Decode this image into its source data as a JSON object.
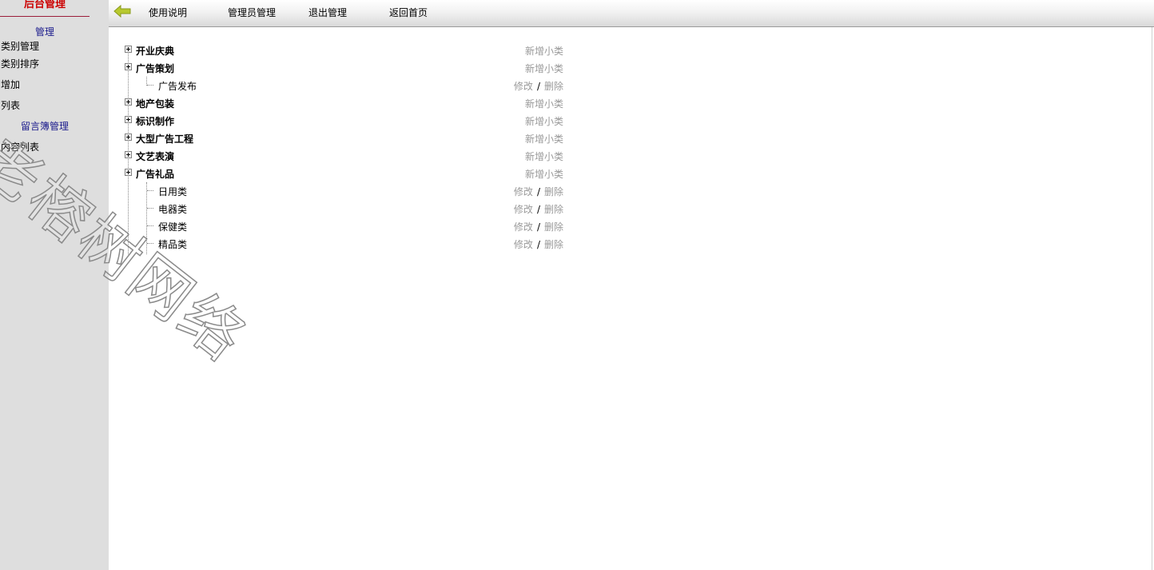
{
  "sidebar": {
    "title": "后台管理",
    "groups": [
      {
        "label": "管理",
        "items": [
          "类别管理",
          "类别排序",
          "增加",
          "列表"
        ]
      },
      {
        "label": "留言簿管理",
        "items": [
          "内容列表"
        ]
      }
    ]
  },
  "topbar": {
    "back_icon": "arrow-left-icon",
    "links": [
      "使用说明",
      "管理员管理",
      "退出管理",
      "返回首页"
    ]
  },
  "tree": {
    "categories": [
      {
        "name": "开业庆典",
        "action": "新增小类",
        "children": []
      },
      {
        "name": "广告策划",
        "action": "新增小类",
        "children": [
          {
            "name": "广告发布",
            "edit": "修改",
            "sep": "/",
            "delete": "删除"
          }
        ]
      },
      {
        "name": "地产包装",
        "action": "新增小类",
        "children": []
      },
      {
        "name": "标识制作",
        "action": "新增小类",
        "children": []
      },
      {
        "name": "大型广告工程",
        "action": "新增小类",
        "children": []
      },
      {
        "name": "文艺表演",
        "action": "新增小类",
        "children": []
      },
      {
        "name": "广告礼品",
        "action": "新增小类",
        "children": [
          {
            "name": "日用类",
            "edit": "修改",
            "sep": "/",
            "delete": "删除"
          },
          {
            "name": "电器类",
            "edit": "修改",
            "sep": "/",
            "delete": "删除"
          },
          {
            "name": "保健类",
            "edit": "修改",
            "sep": "/",
            "delete": "删除"
          },
          {
            "name": "精品类",
            "edit": "修改",
            "sep": "/",
            "delete": "删除"
          }
        ]
      }
    ]
  },
  "watermark": "老榕树网络",
  "colors": {
    "sidebar_bg": "#dedede",
    "title_red": "#cc0000",
    "group_blue": "#1a1a8c",
    "action_gray": "#999999",
    "back_arrow": "#b8c92e"
  }
}
